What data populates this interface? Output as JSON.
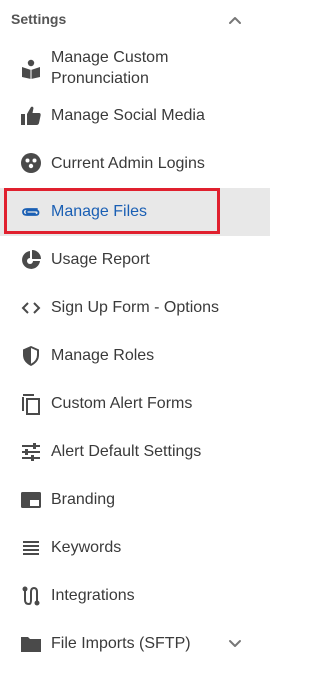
{
  "section": {
    "title": "Settings",
    "collapse_icon": "chevron-up-icon"
  },
  "menu": {
    "items": [
      {
        "label_line1": "Manage Custom",
        "label_line2": "Pronunciation",
        "icon": "book-speak-icon"
      },
      {
        "label": "Manage Social Media",
        "icon": "thumbs-up-icon"
      },
      {
        "label": "Current Admin Logins",
        "icon": "users-circle-icon"
      },
      {
        "label": "Manage Files",
        "icon": "paperclip-icon",
        "active": true
      },
      {
        "label": "Usage Report",
        "icon": "pie-chart-icon"
      },
      {
        "label": "Sign Up Form - Options",
        "icon": "code-icon"
      },
      {
        "label": "Manage Roles",
        "icon": "shield-icon"
      },
      {
        "label": "Custom Alert Forms",
        "icon": "copy-icon"
      },
      {
        "label": "Alert Default Settings",
        "icon": "sliders-icon"
      },
      {
        "label": "Branding",
        "icon": "branding-icon"
      },
      {
        "label": "Keywords",
        "icon": "list-icon"
      },
      {
        "label": "Integrations",
        "icon": "integrations-icon"
      },
      {
        "label": "File Imports (SFTP)",
        "icon": "folder-icon",
        "expand_icon": "chevron-down-icon"
      }
    ]
  },
  "colors": {
    "icon": "#4a4a4a",
    "active_text": "#1a5fb4",
    "active_bg": "#e8e8e8",
    "highlight_border": "#e0202e"
  }
}
